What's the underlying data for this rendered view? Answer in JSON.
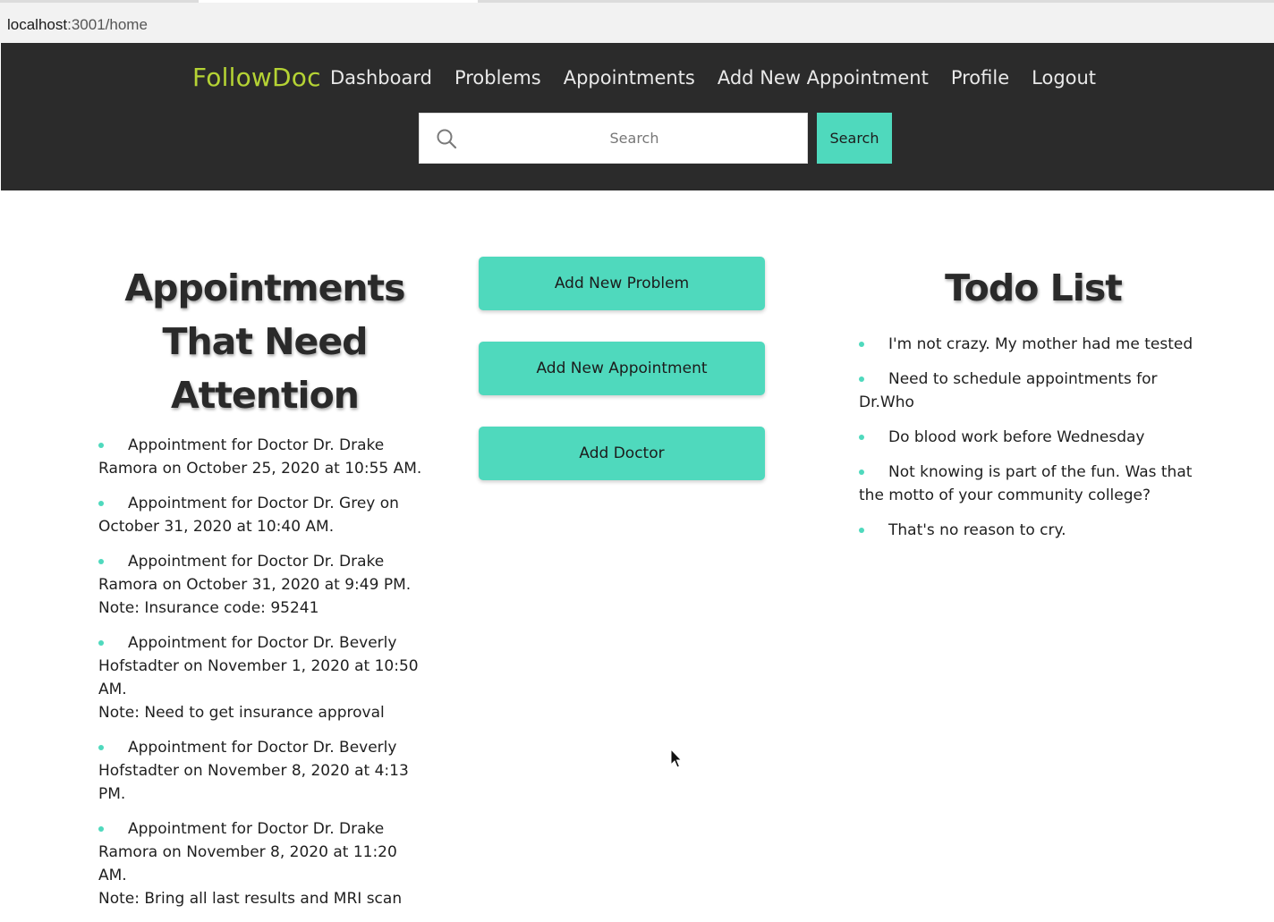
{
  "browser": {
    "url_host": "localhost",
    "url_rest": ":3001/home"
  },
  "nav": {
    "brand": "FollowDoc",
    "links": [
      "Dashboard",
      "Problems",
      "Appointments",
      "Add New Appointment",
      "Profile",
      "Logout"
    ],
    "search_placeholder": "Search",
    "search_button": "Search"
  },
  "attention": {
    "title": "Appointments That Need Attention",
    "items": [
      {
        "text": "Appointment for Doctor Dr. Drake Ramora on October 25, 2020 at 10:55 AM.",
        "note": ""
      },
      {
        "text": "Appointment for Doctor Dr. Grey on October 31, 2020 at 10:40 AM.",
        "note": ""
      },
      {
        "text": "Appointment for Doctor Dr. Drake Ramora on October 31, 2020 at 9:49 PM.",
        "note": "Note: Insurance code: 95241"
      },
      {
        "text": "Appointment for Doctor Dr. Beverly Hofstadter on November 1, 2020 at 10:50 AM.",
        "note": "Note: Need to get insurance approval"
      },
      {
        "text": "Appointment for Doctor Dr. Beverly Hofstadter on November 8, 2020 at 4:13 PM.",
        "note": ""
      },
      {
        "text": "Appointment for Doctor Dr. Drake Ramora on November 8, 2020 at 11:20 AM.",
        "note": "Note: Bring all last results and MRI scan"
      }
    ]
  },
  "actions": {
    "add_problem": "Add New Problem",
    "add_appointment": "Add New Appointment",
    "add_doctor": "Add Doctor"
  },
  "todo": {
    "title": "Todo List",
    "items": [
      "I'm not crazy. My mother had me tested",
      "Need to schedule appointments for Dr.Who",
      "Do blood work before Wednesday",
      "Not knowing is part of the fun. Was that the motto of your community college?",
      "That's no reason to cry."
    ]
  },
  "colors": {
    "accent": "#4fd9bd",
    "brand": "#b5d334",
    "nav_bg": "#2b2b2b"
  }
}
